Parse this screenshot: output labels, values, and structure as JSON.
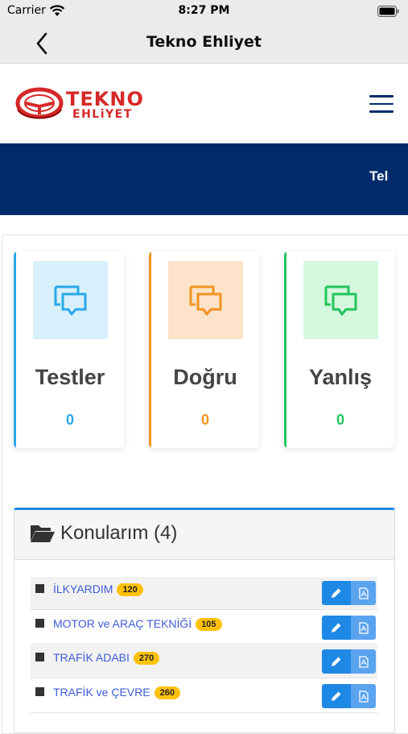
{
  "status_bar": {
    "carrier": "Carrier",
    "time": "8:27 PM"
  },
  "nav": {
    "title": "Tekno Ehliyet",
    "back_icon": "chevron-left-icon"
  },
  "header": {
    "logo_line1": "TEKNO",
    "logo_line2": "EHLiYET",
    "menu_icon": "hamburger-icon"
  },
  "banner": {
    "text": "Tel"
  },
  "stats": [
    {
      "label": "Testler",
      "value": "0",
      "color": "#29a8ea",
      "icon_bg": "#d8f0fb",
      "icon": "chat-bubbles-icon"
    },
    {
      "label": "Doğru",
      "value": "0",
      "color": "#f39322",
      "icon_bg": "#fde3c9",
      "icon": "chat-bubbles-icon"
    },
    {
      "label": "Yanlış",
      "value": "0",
      "color": "#22c55e",
      "icon_bg": "#d4f7de",
      "icon": "chat-bubbles-icon"
    }
  ],
  "topics": {
    "title": "Konularım (4)",
    "icon": "folder-open-icon",
    "items": [
      {
        "name": "İLKYARDIM",
        "count": "120"
      },
      {
        "name": "MOTOR ve ARAÇ TEKNİĞİ",
        "count": "105"
      },
      {
        "name": "TRAFİK ADABI",
        "count": "270"
      },
      {
        "name": "TRAFİK ve ÇEVRE",
        "count": "260"
      }
    ],
    "row_actions": [
      "pencil-icon",
      "pdf-file-icon"
    ]
  },
  "colors": {
    "navy": "#002b6b",
    "brand_red": "#d62828",
    "accent_blue": "#1e88e5",
    "badge_yellow": "#ffc107"
  }
}
